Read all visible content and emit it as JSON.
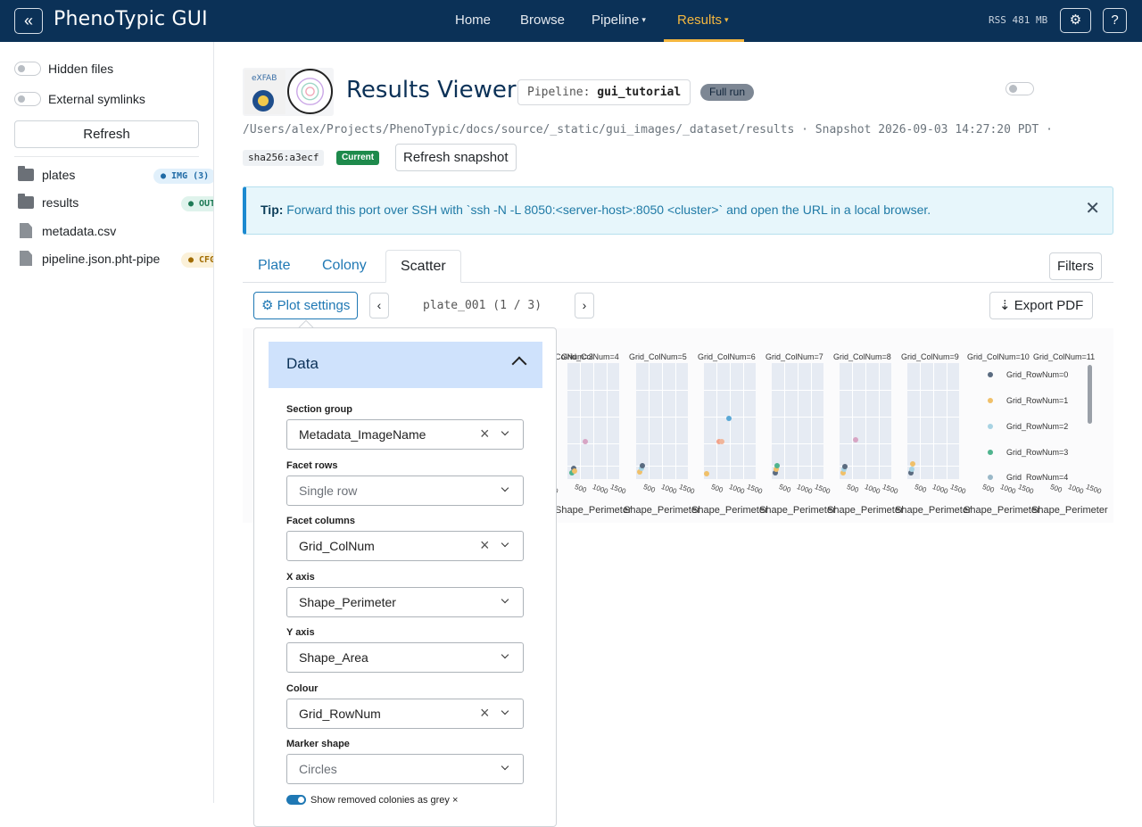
{
  "navbar": {
    "collapse": "«",
    "brand": "PhenoTypic GUI",
    "items": [
      {
        "label": "Home",
        "caret": ""
      },
      {
        "label": "Browse",
        "caret": ""
      },
      {
        "label": "Pipeline",
        "caret": "▾"
      },
      {
        "label": "Results",
        "caret": "▾"
      }
    ],
    "rss": "RSS 481 MB",
    "settings_icon": "⚙",
    "help": "?"
  },
  "sidebar": {
    "hidden_files": "Hidden files",
    "external_symlinks": "External symlinks",
    "refresh": "Refresh",
    "files": [
      {
        "name": "plates",
        "badge": "● IMG (3)"
      },
      {
        "name": "results",
        "badge": "● OUT"
      },
      {
        "name": "metadata.csv",
        "badge": ""
      },
      {
        "name": "pipeline.json.pht-pipe",
        "badge": "● CFG"
      }
    ]
  },
  "header": {
    "title": "Results Viewer",
    "pipeline_label": "Pipeline:",
    "pipeline_name": "gui_tutorial",
    "run_badge": "Full run",
    "path": "/Users/alex/Projects/PhenoTypic/docs/source/_static/gui_images/_dataset/results · Snapshot 2026-09-03 14:27:20 PDT ·",
    "sha": "sha256:a3ecf",
    "current": "Current",
    "refresh_snapshot": "Refresh snapshot"
  },
  "tip": {
    "label": "Tip:",
    "text": "Forward this port over SSH with `ssh -N -L 8050:<server-host>:8050 <cluster>` and open the URL in a local browser.",
    "close": "✕"
  },
  "tabs": [
    "Plate",
    "Colony",
    "Scatter"
  ],
  "toolbar": {
    "filters": "Filters",
    "plot_settings": "⚙ Plot settings",
    "prev": "‹",
    "next": "›",
    "page": "plate_001 (1 / 3)",
    "export": "⇣ Export PDF"
  },
  "plot_settings": {
    "section": "Data",
    "fields": [
      {
        "label": "Section group",
        "value": "Metadata_ImageName",
        "placeholder": false,
        "clearable": true
      },
      {
        "label": "Facet rows",
        "value": "Single row",
        "placeholder": true,
        "clearable": false
      },
      {
        "label": "Facet columns",
        "value": "Grid_ColNum",
        "placeholder": false,
        "clearable": true
      },
      {
        "label": "X axis",
        "value": "Shape_Perimeter",
        "placeholder": false,
        "clearable": false
      },
      {
        "label": "Y axis",
        "value": "Shape_Area",
        "placeholder": false,
        "clearable": false
      },
      {
        "label": "Colour",
        "value": "Grid_RowNum",
        "placeholder": false,
        "clearable": true
      },
      {
        "label": "Marker shape",
        "value": "Circles",
        "placeholder": true,
        "clearable": false
      }
    ],
    "show_removed": "Show removed colonies as grey ×"
  },
  "chart_data": {
    "type": "scatter",
    "facets": [
      "Grid_ColNum=3",
      "Grid_ColNum=4",
      "Grid_ColNum=5",
      "Grid_ColNum=6",
      "Grid_ColNum=7",
      "Grid_ColNum=8",
      "Grid_ColNum=9",
      "Grid_ColNum=10",
      "Grid_ColNum=11"
    ],
    "xlabel": "Shape_Perimeter",
    "xticks": [
      "500",
      "1000",
      "1500"
    ],
    "legend": [
      {
        "name": "Grid_RowNum=0",
        "color": "#5a6b80"
      },
      {
        "name": "Grid_RowNum=1",
        "color": "#f0c069"
      },
      {
        "name": "Grid_RowNum=2",
        "color": "#a8d3e3"
      },
      {
        "name": "Grid_RowNum=3",
        "color": "#4fb48e"
      },
      {
        "name": "Grid_RowNum=4",
        "color": "#9ab8c8"
      }
    ],
    "legend_placement": "right",
    "grid": true
  }
}
